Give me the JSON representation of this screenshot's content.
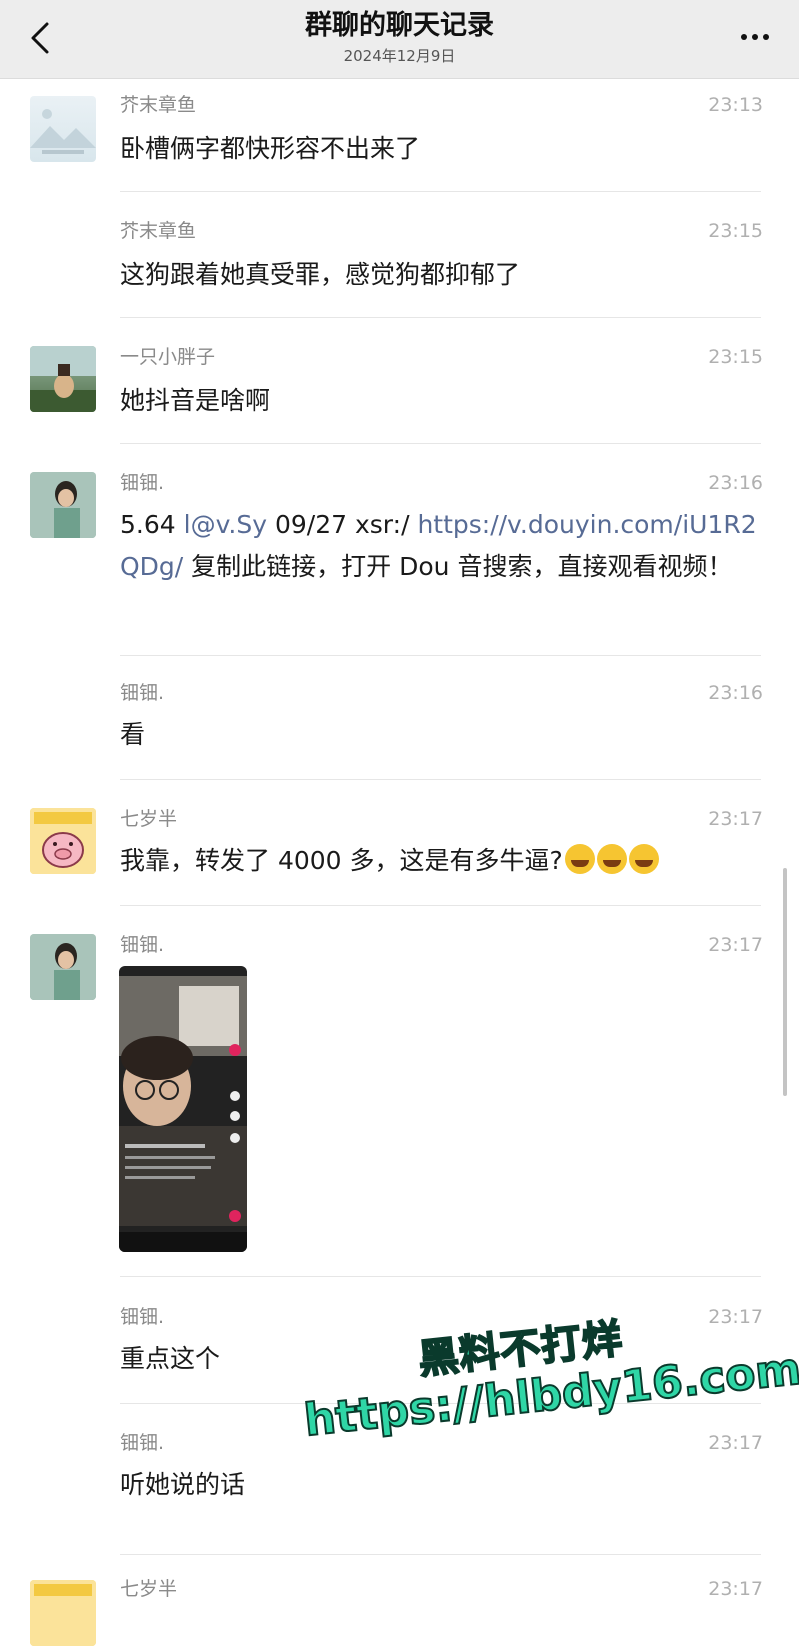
{
  "header": {
    "title": "群聊的聊天记录",
    "date": "2024年12月9日"
  },
  "messages": [
    {
      "sender": "芥末章鱼",
      "time": "23:13",
      "text": "卧槽俩字都快形容不出来了",
      "avatar": "landscape-placeholder"
    },
    {
      "sender": "芥末章鱼",
      "time": "23:15",
      "text": "这狗跟着她真受罪，感觉狗都抑郁了"
    },
    {
      "sender": "一只小胖子",
      "time": "23:15",
      "text": "她抖音是啥啊",
      "avatar": "garden-photo"
    },
    {
      "sender": "钿钿.",
      "time": "23:16",
      "text_plain1": "5.64 ",
      "link1": "l@v.Sy",
      "text_plain2": " 09/27 xsr:/  ",
      "link2": "https://v.douyin.com/iU1R2QDg/",
      "text_plain3": " 复制此链接，打开 Dou 音搜索，直接观看视频！",
      "avatar": "girl-photo"
    },
    {
      "sender": "钿钿.",
      "time": "23:16",
      "text": "看"
    },
    {
      "sender": "七岁半",
      "time": "23:17",
      "text": "我靠，转发了 4000 多，这是有多牛逼?",
      "emoji_count": 3,
      "avatar": "pig-sticker"
    },
    {
      "sender": "钿钿.",
      "time": "23:17",
      "image": "video-screenshot",
      "avatar": "girl-photo"
    },
    {
      "sender": "钿钿.",
      "time": "23:17",
      "text": "重点这个"
    },
    {
      "sender": "钿钿.",
      "time": "23:17",
      "text": "听她说的话"
    },
    {
      "sender": "七岁半",
      "time": "23:17",
      "avatar": "pig-sticker"
    }
  ],
  "watermark": {
    "line1": "黑料不打烊",
    "line2": "https://hlbdy16.com"
  },
  "colors": {
    "link": "#576b95",
    "watermark": "#2fd6a6",
    "header_bg": "#ededed"
  }
}
